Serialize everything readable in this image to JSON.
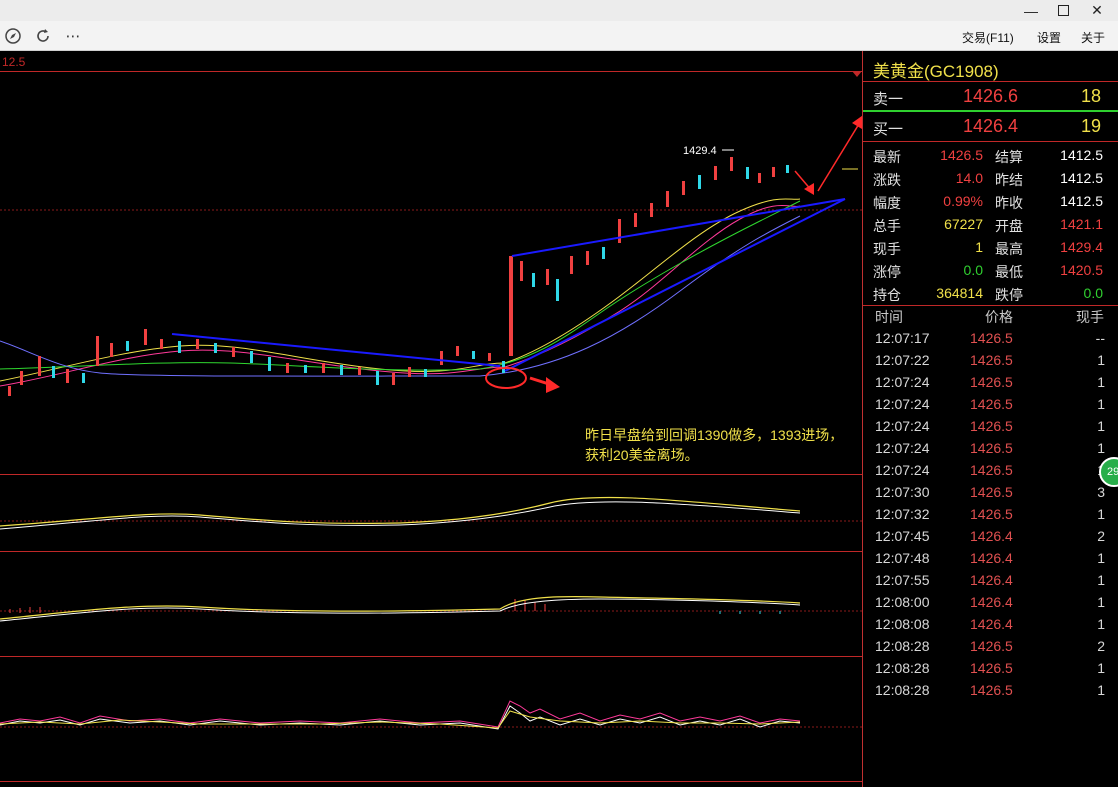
{
  "toolbar": {
    "menus": [
      "交易(F11)",
      "设置",
      "关于"
    ]
  },
  "chart": {
    "top_price_label": "12.5",
    "high_marker": "1429.4",
    "annotation": "昨日早盘给到回调1390做多，1393进场，获利20美金离场。"
  },
  "instrument": {
    "name": "美黄金(GC1908)"
  },
  "quote": {
    "ask_label": "卖一",
    "ask_price": "1426.6",
    "ask_vol": "18",
    "bid_label": "买一",
    "bid_price": "1426.4",
    "bid_vol": "19"
  },
  "stats": {
    "left": [
      {
        "label": "最新",
        "value": "1426.5",
        "color": "#f04040"
      },
      {
        "label": "涨跌",
        "value": "14.0",
        "color": "#f04040"
      },
      {
        "label": "幅度",
        "value": "0.99%",
        "color": "#f04040"
      },
      {
        "label": "总手",
        "value": "67227",
        "color": "#f0e04a"
      },
      {
        "label": "现手",
        "value": "1",
        "color": "#f0e04a"
      },
      {
        "label": "涨停",
        "value": "0.0",
        "color": "#30d030"
      },
      {
        "label": "持仓",
        "value": "364814",
        "color": "#f0e04a"
      }
    ],
    "right": [
      {
        "label": "结算",
        "value": "1412.5",
        "color": "#ffffff"
      },
      {
        "label": "昨结",
        "value": "1412.5",
        "color": "#ffffff"
      },
      {
        "label": "昨收",
        "value": "1412.5",
        "color": "#ffffff"
      },
      {
        "label": "开盘",
        "value": "1421.1",
        "color": "#f04040"
      },
      {
        "label": "最高",
        "value": "1429.4",
        "color": "#f04040"
      },
      {
        "label": "最低",
        "value": "1420.5",
        "color": "#f04040"
      },
      {
        "label": "跌停",
        "value": "0.0",
        "color": "#30d030"
      }
    ]
  },
  "ticks": {
    "headers": {
      "time": "时间",
      "price": "价格",
      "vol": "现手"
    },
    "rows": [
      {
        "time": "12:07:17",
        "price": "1426.5",
        "vol": "--"
      },
      {
        "time": "12:07:22",
        "price": "1426.5",
        "vol": "1"
      },
      {
        "time": "12:07:24",
        "price": "1426.5",
        "vol": "1"
      },
      {
        "time": "12:07:24",
        "price": "1426.5",
        "vol": "1"
      },
      {
        "time": "12:07:24",
        "price": "1426.5",
        "vol": "1"
      },
      {
        "time": "12:07:24",
        "price": "1426.5",
        "vol": "1"
      },
      {
        "time": "12:07:24",
        "price": "1426.5",
        "vol": "1"
      },
      {
        "time": "12:07:30",
        "price": "1426.5",
        "vol": "3"
      },
      {
        "time": "12:07:32",
        "price": "1426.5",
        "vol": "1"
      },
      {
        "time": "12:07:45",
        "price": "1426.4",
        "vol": "2"
      },
      {
        "time": "12:07:48",
        "price": "1426.4",
        "vol": "1"
      },
      {
        "time": "12:07:55",
        "price": "1426.4",
        "vol": "1"
      },
      {
        "time": "12:08:00",
        "price": "1426.4",
        "vol": "1"
      },
      {
        "time": "12:08:08",
        "price": "1426.4",
        "vol": "1"
      },
      {
        "time": "12:08:28",
        "price": "1426.5",
        "vol": "2"
      },
      {
        "time": "12:08:28",
        "price": "1426.5",
        "vol": "1"
      },
      {
        "time": "12:08:28",
        "price": "1426.5",
        "vol": "1"
      }
    ]
  },
  "badge": {
    "text": "29"
  },
  "colors": {
    "up": "#f04040",
    "down": "#2fd8e8",
    "accent": "#f0e04a",
    "trend": "#1a1aff"
  }
}
